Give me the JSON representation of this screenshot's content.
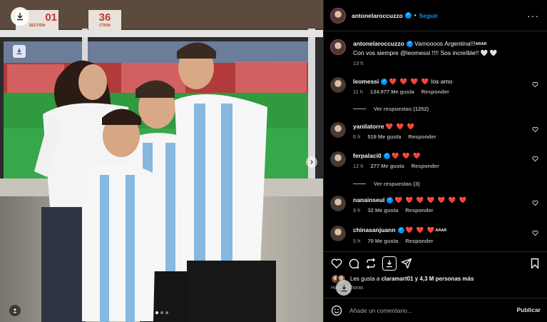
{
  "photo": {
    "sign_left": "01",
    "sign_left_sub": "SECTION",
    "sign_right": "36",
    "sign_right_sub": "CTION",
    "carousel_count": 3,
    "carousel_active": 0,
    "icons": {
      "download": "download-icon",
      "save": "save-to-device-icon",
      "next": "chevron-right-icon",
      "tags": "user-tag-icon"
    }
  },
  "header": {
    "username": "antonelaroccuzzo",
    "separator": "•",
    "follow_label": "Seguir",
    "more_label": "···"
  },
  "caption": {
    "username": "antonelaroccuzzo",
    "text_1": "Vamoooos Argentina!!!",
    "flag_text": "ARAR",
    "line2_prefix": "Con vos siempre ",
    "mention": "@leomessi",
    "line2_suffix": " !!!! Sos increíble!! 🤍 🤍",
    "time": "13 h"
  },
  "comments": [
    {
      "username": "leomessi",
      "verified": true,
      "hearts": "❤️ ❤️ ❤️ ❤️",
      "text": " los amo",
      "extra": "",
      "time": "11 h",
      "likes": "134.977 Me gusta",
      "reply": "Responder",
      "view_replies": "Ver respuestas (1252)"
    },
    {
      "username": "yanilatorre",
      "verified": false,
      "hearts": "❤️ ❤️ ❤️",
      "text": "",
      "extra": "",
      "time": "6 h",
      "likes": "519 Me gusta",
      "reply": "Responder",
      "view_replies": ""
    },
    {
      "username": "ferpalaci0",
      "verified": true,
      "hearts": "❤️ ❤️ ❤️",
      "text": "",
      "extra": "",
      "time": "12 h",
      "likes": "277 Me gusta",
      "reply": "Responder",
      "view_replies": "Ver respuestas (3)"
    },
    {
      "username": "nanainseul",
      "verified": true,
      "hearts": "❤️ ❤️ ❤️ ❤️ ❤️ ❤️ ❤️",
      "text": "",
      "extra": "",
      "time": "9 h",
      "likes": "32 Me gusta",
      "reply": "Responder",
      "view_replies": ""
    },
    {
      "username": "chinasanjuann",
      "verified": true,
      "hearts": "❤️ ❤️ ❤️",
      "text": "",
      "extra": "ARAR",
      "time": "5 h",
      "likes": "70 Me gusta",
      "reply": "Responder",
      "view_replies": ""
    }
  ],
  "actions": {
    "like": "heart-icon",
    "comment": "comment-icon",
    "repost": "repost-icon",
    "download": "download-icon",
    "share": "send-icon",
    "save": "bookmark-icon"
  },
  "likes": {
    "prefix": "Les gusta a ",
    "user": "claramart01",
    "suffix": " y 4,3 M personas más",
    "time": "Hace 13 horas"
  },
  "comment_box": {
    "placeholder": "Añade un comentario...",
    "publish_label": "Publicar"
  },
  "colors": {
    "accent": "#0095f6",
    "heart": "#ff3040",
    "background": "#000000",
    "muted": "#a8a8a8"
  }
}
